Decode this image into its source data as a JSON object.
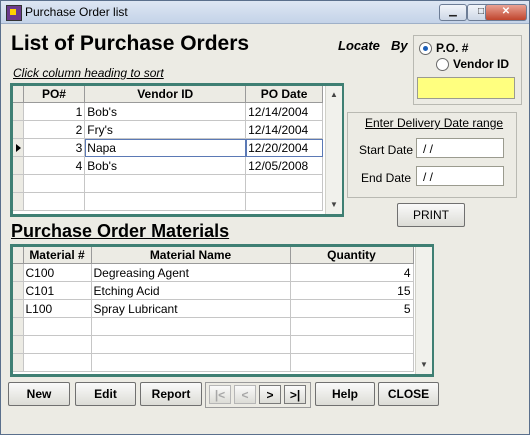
{
  "window": {
    "title": "Purchase Order list",
    "minimize": "▁",
    "maximize": "□",
    "close": "✕"
  },
  "header": {
    "title": "List of Purchase Orders",
    "hint": "Click column heading to sort"
  },
  "locate": {
    "label": "Locate",
    "by": "By",
    "options": [
      "P.O. #",
      "Vendor ID"
    ],
    "selected": "P.O. #",
    "value": ""
  },
  "po_table": {
    "columns": [
      "PO#",
      "Vendor ID",
      "PO Date"
    ],
    "rows": [
      {
        "po": "1",
        "vendor": "Bob's",
        "date": "12/14/2004"
      },
      {
        "po": "2",
        "vendor": "Fry's",
        "date": "12/14/2004"
      },
      {
        "po": "3",
        "vendor": "Napa",
        "date": "12/20/2004"
      },
      {
        "po": "4",
        "vendor": "Bob's",
        "date": "12/05/2008"
      }
    ],
    "current_row": 3
  },
  "date_range": {
    "legend": "Enter Delivery Date range",
    "start_label": "Start Date",
    "start_value": "/ /",
    "end_label": "End Date",
    "end_value": "/ /"
  },
  "print_button": "PRINT",
  "materials": {
    "title": "Purchase Order Materials",
    "columns": [
      "Material #",
      "Material Name",
      "Quantity"
    ],
    "rows": [
      {
        "id": "C100",
        "name": "Degreasing Agent",
        "qty": "4"
      },
      {
        "id": "C101",
        "name": "Etching Acid",
        "qty": "15"
      },
      {
        "id": "L100",
        "name": "Spray Lubricant",
        "qty": "5"
      }
    ]
  },
  "buttons": {
    "new": "New",
    "edit": "Edit",
    "report": "Report",
    "help": "Help",
    "close": "CLOSE"
  },
  "nav": {
    "first": "|<",
    "prev": "<",
    "next": ">",
    "last": ">|"
  },
  "colors": {
    "grid_border": "#3f7f73",
    "locate_input": "#ffff7f",
    "window_bg": "#ecebe4"
  }
}
